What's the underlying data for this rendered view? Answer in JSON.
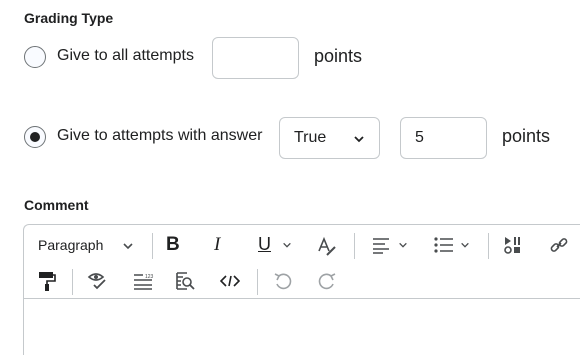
{
  "grading": {
    "section_label": "Grading Type",
    "option_all": {
      "label": "Give to all attempts",
      "value": "",
      "units": "points",
      "selected": false
    },
    "option_answer": {
      "label": "Give to attempts with answer",
      "answer_select": "True",
      "value": "5",
      "units": "points",
      "selected": true
    }
  },
  "comment": {
    "section_label": "Comment",
    "toolbar": {
      "block_format": "Paragraph",
      "bold_glyph": "B",
      "italic_glyph": "I",
      "underline_glyph": "U",
      "icons": [
        "chevron-down-icon",
        "bold-icon",
        "italic-icon",
        "underline-icon",
        "text-color-icon",
        "align-icon",
        "bullet-list-icon",
        "insert-media-icon",
        "link-icon",
        "format-painter-icon",
        "accessibility-checker-icon",
        "word-count-icon",
        "preview-icon",
        "source-code-icon",
        "undo-icon",
        "redo-icon"
      ]
    }
  },
  "colors": {
    "text": "#202122",
    "border": "#c5c9cc",
    "icon": "#494c4e"
  }
}
